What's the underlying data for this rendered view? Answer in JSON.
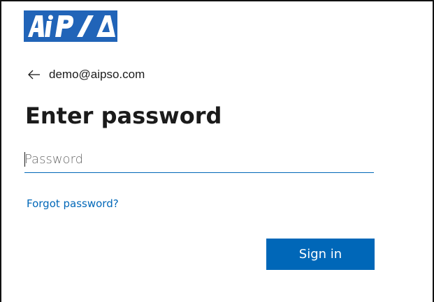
{
  "logo": {
    "text": "AIPSO",
    "icon": "aipso-logo",
    "bg_color": "#2164b8",
    "fg_color": "#ffffff"
  },
  "back": {
    "icon": "arrow-left-icon",
    "email": "demo@aipso.com"
  },
  "title": "Enter password",
  "password": {
    "value": "",
    "placeholder": "Password"
  },
  "forgot_label": "Forgot password?",
  "signin_label": "Sign in",
  "colors": {
    "accent": "#0067b8",
    "text": "#1b1b1b"
  }
}
